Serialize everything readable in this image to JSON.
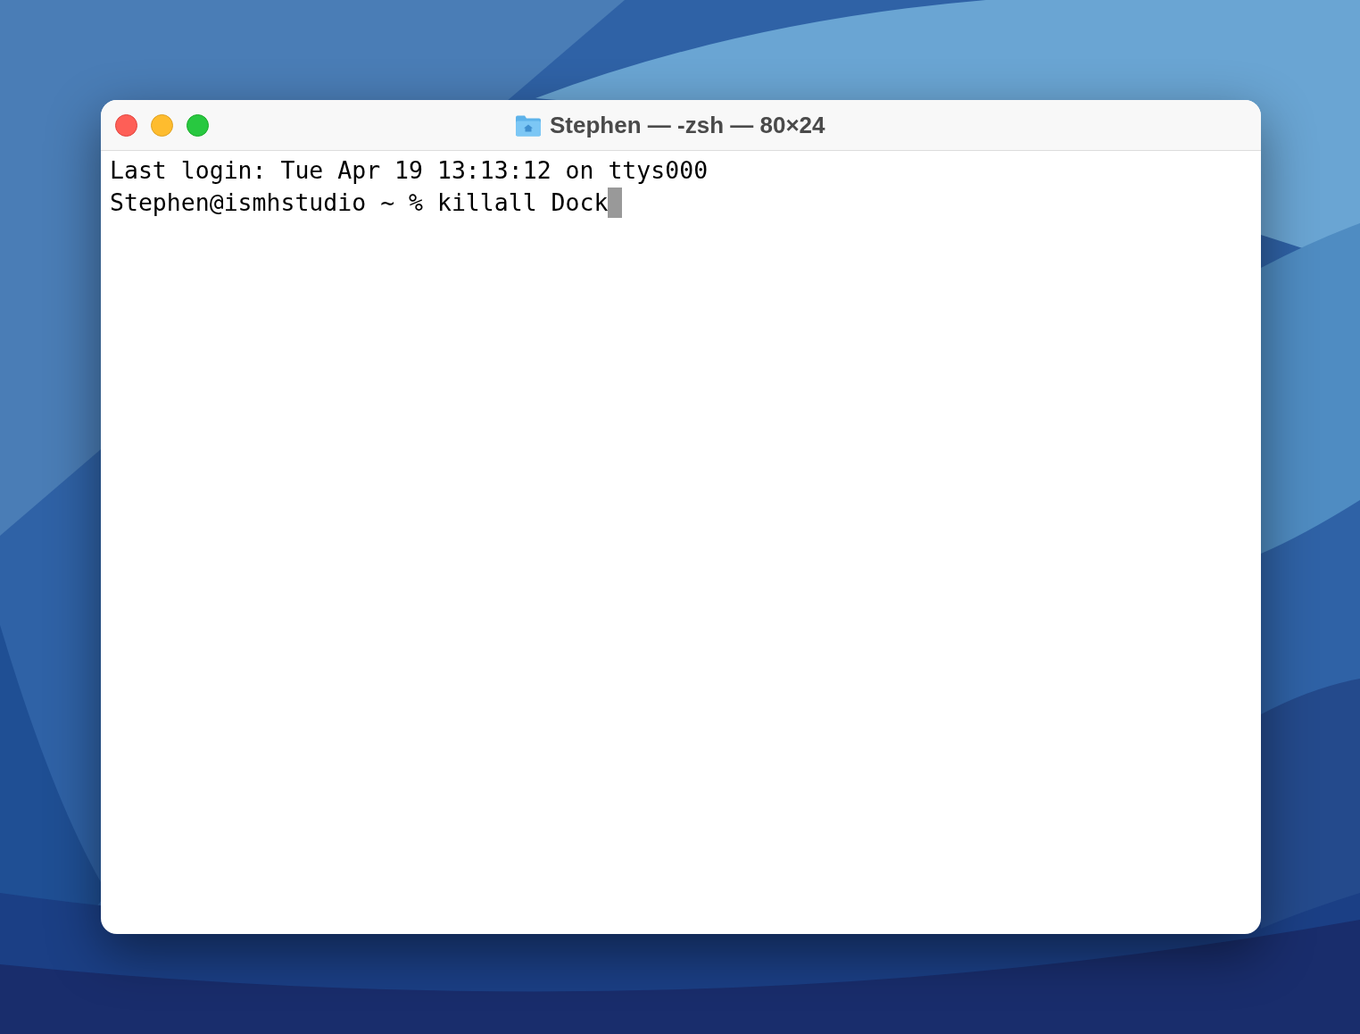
{
  "window": {
    "title": "Stephen — -zsh — 80×24"
  },
  "terminal": {
    "lines": [
      {
        "text": "Last login: Tue Apr 19 13:13:12 on ttys000",
        "cursor": false
      },
      {
        "text": "Stephen@ismhstudio ~ % killall Dock",
        "cursor": true
      }
    ]
  }
}
